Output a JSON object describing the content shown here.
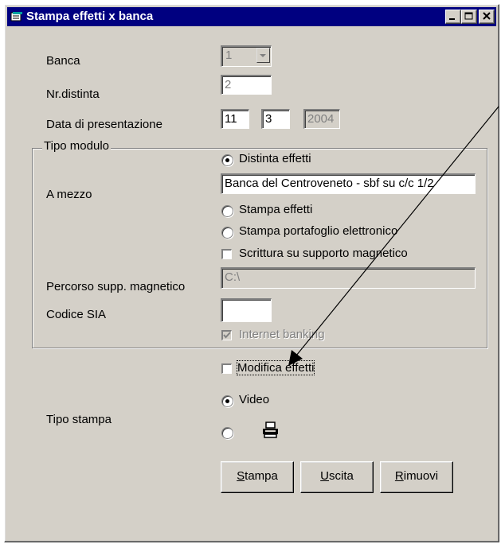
{
  "window": {
    "title": "Stampa effetti x banca"
  },
  "form": {
    "banca_label": "Banca",
    "banca_value": "1",
    "distinta_label": "Nr.distinta",
    "distinta_value": "2",
    "data_label": "Data di presentazione",
    "data_day": "11",
    "data_month": "3",
    "data_year": "2004",
    "group_title": "Tipo modulo",
    "a_mezzo_label": "A mezzo",
    "opt_distinta": "Distinta effetti",
    "a_mezzo_value": "Banca del Centroveneto - sbf su c/c 1/2",
    "opt_stampa_effetti": "Stampa effetti",
    "opt_portafoglio": "Stampa portafoglio elettronico",
    "chk_scrittura": "Scrittura su supporto magnetico",
    "percorso_label": "Percorso supp. magnetico",
    "percorso_value": "C:\\",
    "sia_label": "Codice SIA",
    "sia_value": "",
    "chk_internet": "Internet banking",
    "chk_modifica": "Modifica effetti",
    "tipo_stampa_label": "Tipo stampa",
    "opt_video": "Video"
  },
  "buttons": {
    "stampa_first": "S",
    "stampa_rest": "tampa",
    "uscita_first": "U",
    "uscita_rest": "scita",
    "rimuovi_first": "R",
    "rimuovi_rest": "imuovi"
  },
  "state": {
    "tipo_modulo_selected": "Distinta effetti",
    "tipo_stampa_selected": "Video",
    "scrittura_checked": false,
    "internet_checked": true,
    "modifica_checked": false
  },
  "icons": [
    "app-icon",
    "minimize-icon",
    "maximize-icon",
    "close-icon",
    "combo-arrow-icon",
    "printer-icon"
  ],
  "colors": {
    "titlebar": "#000080",
    "face": "#d4d0c8"
  }
}
